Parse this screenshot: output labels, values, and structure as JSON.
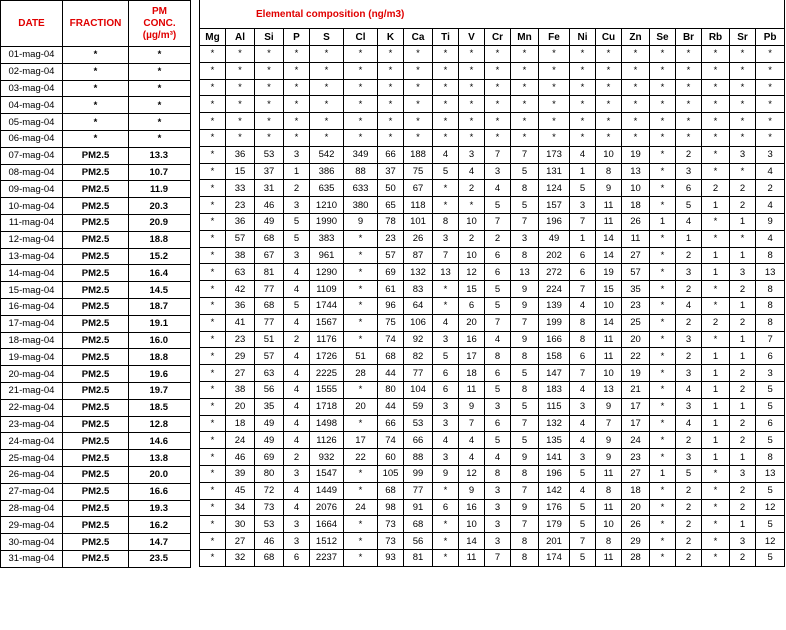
{
  "left_headers": {
    "date": "DATE",
    "fraction": "FRACTION",
    "conc_line1": "PM",
    "conc_line2": "CONC.",
    "conc_line3": "(µg/m³)"
  },
  "right_title": "Elemental composition (ng/m3)",
  "elements": [
    "Mg",
    "Al",
    "Si",
    "P",
    "S",
    "Cl",
    "K",
    "Ca",
    "Ti",
    "V",
    "Cr",
    "Mn",
    "Fe",
    "Ni",
    "Cu",
    "Zn",
    "Se",
    "Br",
    "Rb",
    "Sr",
    "Pb"
  ],
  "rows": [
    {
      "date": "01-mag-04",
      "fraction": "*",
      "conc": "*",
      "values": [
        "*",
        "*",
        "*",
        "*",
        "*",
        "*",
        "*",
        "*",
        "*",
        "*",
        "*",
        "*",
        "*",
        "*",
        "*",
        "*",
        "*",
        "*",
        "*",
        "*",
        "*"
      ]
    },
    {
      "date": "02-mag-04",
      "fraction": "*",
      "conc": "*",
      "values": [
        "*",
        "*",
        "*",
        "*",
        "*",
        "*",
        "*",
        "*",
        "*",
        "*",
        "*",
        "*",
        "*",
        "*",
        "*",
        "*",
        "*",
        "*",
        "*",
        "*",
        "*"
      ]
    },
    {
      "date": "03-mag-04",
      "fraction": "*",
      "conc": "*",
      "values": [
        "*",
        "*",
        "*",
        "*",
        "*",
        "*",
        "*",
        "*",
        "*",
        "*",
        "*",
        "*",
        "*",
        "*",
        "*",
        "*",
        "*",
        "*",
        "*",
        "*",
        "*"
      ]
    },
    {
      "date": "04-mag-04",
      "fraction": "*",
      "conc": "*",
      "values": [
        "*",
        "*",
        "*",
        "*",
        "*",
        "*",
        "*",
        "*",
        "*",
        "*",
        "*",
        "*",
        "*",
        "*",
        "*",
        "*",
        "*",
        "*",
        "*",
        "*",
        "*"
      ]
    },
    {
      "date": "05-mag-04",
      "fraction": "*",
      "conc": "*",
      "values": [
        "*",
        "*",
        "*",
        "*",
        "*",
        "*",
        "*",
        "*",
        "*",
        "*",
        "*",
        "*",
        "*",
        "*",
        "*",
        "*",
        "*",
        "*",
        "*",
        "*",
        "*"
      ]
    },
    {
      "date": "06-mag-04",
      "fraction": "*",
      "conc": "*",
      "values": [
        "*",
        "*",
        "*",
        "*",
        "*",
        "*",
        "*",
        "*",
        "*",
        "*",
        "*",
        "*",
        "*",
        "*",
        "*",
        "*",
        "*",
        "*",
        "*",
        "*",
        "*"
      ]
    },
    {
      "date": "07-mag-04",
      "fraction": "PM2.5",
      "conc": "13.3",
      "values": [
        "*",
        "36",
        "53",
        "3",
        "542",
        "349",
        "66",
        "188",
        "4",
        "3",
        "7",
        "7",
        "173",
        "4",
        "10",
        "19",
        "*",
        "2",
        "*",
        "3",
        "3"
      ]
    },
    {
      "date": "08-mag-04",
      "fraction": "PM2.5",
      "conc": "10.7",
      "values": [
        "*",
        "15",
        "37",
        "1",
        "386",
        "88",
        "37",
        "75",
        "5",
        "4",
        "3",
        "5",
        "131",
        "1",
        "8",
        "13",
        "*",
        "3",
        "*",
        "*",
        "4"
      ]
    },
    {
      "date": "09-mag-04",
      "fraction": "PM2.5",
      "conc": "11.9",
      "values": [
        "*",
        "33",
        "31",
        "2",
        "635",
        "633",
        "50",
        "67",
        "*",
        "2",
        "4",
        "8",
        "124",
        "5",
        "9",
        "10",
        "*",
        "6",
        "2",
        "2",
        "2"
      ]
    },
    {
      "date": "10-mag-04",
      "fraction": "PM2.5",
      "conc": "20.3",
      "values": [
        "*",
        "23",
        "46",
        "3",
        "1210",
        "380",
        "65",
        "118",
        "*",
        "*",
        "5",
        "5",
        "157",
        "3",
        "11",
        "18",
        "*",
        "5",
        "1",
        "2",
        "4"
      ]
    },
    {
      "date": "11-mag-04",
      "fraction": "PM2.5",
      "conc": "20.9",
      "values": [
        "*",
        "36",
        "49",
        "5",
        "1990",
        "9",
        "78",
        "101",
        "8",
        "10",
        "7",
        "7",
        "196",
        "7",
        "11",
        "26",
        "1",
        "4",
        "*",
        "1",
        "9"
      ]
    },
    {
      "date": "12-mag-04",
      "fraction": "PM2.5",
      "conc": "18.8",
      "values": [
        "*",
        "57",
        "68",
        "5",
        "383",
        "*",
        "23",
        "26",
        "3",
        "2",
        "2",
        "3",
        "49",
        "1",
        "14",
        "11",
        "*",
        "1",
        "*",
        "*",
        "4"
      ]
    },
    {
      "date": "13-mag-04",
      "fraction": "PM2.5",
      "conc": "15.2",
      "values": [
        "*",
        "38",
        "67",
        "3",
        "961",
        "*",
        "57",
        "87",
        "7",
        "10",
        "6",
        "8",
        "202",
        "6",
        "14",
        "27",
        "*",
        "2",
        "1",
        "1",
        "8"
      ]
    },
    {
      "date": "14-mag-04",
      "fraction": "PM2.5",
      "conc": "16.4",
      "values": [
        "*",
        "63",
        "81",
        "4",
        "1290",
        "*",
        "69",
        "132",
        "13",
        "12",
        "6",
        "13",
        "272",
        "6",
        "19",
        "57",
        "*",
        "3",
        "1",
        "3",
        "13"
      ]
    },
    {
      "date": "15-mag-04",
      "fraction": "PM2.5",
      "conc": "14.5",
      "values": [
        "*",
        "42",
        "77",
        "4",
        "1109",
        "*",
        "61",
        "83",
        "*",
        "15",
        "5",
        "9",
        "224",
        "7",
        "15",
        "35",
        "*",
        "2",
        "*",
        "2",
        "8"
      ]
    },
    {
      "date": "16-mag-04",
      "fraction": "PM2.5",
      "conc": "18.7",
      "values": [
        "*",
        "36",
        "68",
        "5",
        "1744",
        "*",
        "96",
        "64",
        "*",
        "6",
        "5",
        "9",
        "139",
        "4",
        "10",
        "23",
        "*",
        "4",
        "*",
        "1",
        "8"
      ]
    },
    {
      "date": "17-mag-04",
      "fraction": "PM2.5",
      "conc": "19.1",
      "values": [
        "*",
        "41",
        "77",
        "4",
        "1567",
        "*",
        "75",
        "106",
        "4",
        "20",
        "7",
        "7",
        "199",
        "8",
        "14",
        "25",
        "*",
        "2",
        "2",
        "2",
        "8"
      ]
    },
    {
      "date": "18-mag-04",
      "fraction": "PM2.5",
      "conc": "16.0",
      "values": [
        "*",
        "23",
        "51",
        "2",
        "1176",
        "*",
        "74",
        "92",
        "3",
        "16",
        "4",
        "9",
        "166",
        "8",
        "11",
        "20",
        "*",
        "3",
        "*",
        "1",
        "7"
      ]
    },
    {
      "date": "19-mag-04",
      "fraction": "PM2.5",
      "conc": "18.8",
      "values": [
        "*",
        "29",
        "57",
        "4",
        "1726",
        "51",
        "68",
        "82",
        "5",
        "17",
        "8",
        "8",
        "158",
        "6",
        "11",
        "22",
        "*",
        "2",
        "1",
        "1",
        "6"
      ]
    },
    {
      "date": "20-mag-04",
      "fraction": "PM2.5",
      "conc": "19.6",
      "values": [
        "*",
        "27",
        "63",
        "4",
        "2225",
        "28",
        "44",
        "77",
        "6",
        "18",
        "6",
        "5",
        "147",
        "7",
        "10",
        "19",
        "*",
        "3",
        "1",
        "2",
        "3"
      ]
    },
    {
      "date": "21-mag-04",
      "fraction": "PM2.5",
      "conc": "19.7",
      "values": [
        "*",
        "38",
        "56",
        "4",
        "1555",
        "*",
        "80",
        "104",
        "6",
        "11",
        "5",
        "8",
        "183",
        "4",
        "13",
        "21",
        "*",
        "4",
        "1",
        "2",
        "5"
      ]
    },
    {
      "date": "22-mag-04",
      "fraction": "PM2.5",
      "conc": "18.5",
      "values": [
        "*",
        "20",
        "35",
        "4",
        "1718",
        "20",
        "44",
        "59",
        "3",
        "9",
        "3",
        "5",
        "115",
        "3",
        "9",
        "17",
        "*",
        "3",
        "1",
        "1",
        "5"
      ]
    },
    {
      "date": "23-mag-04",
      "fraction": "PM2.5",
      "conc": "12.8",
      "values": [
        "*",
        "18",
        "49",
        "4",
        "1498",
        "*",
        "66",
        "53",
        "3",
        "7",
        "6",
        "7",
        "132",
        "4",
        "7",
        "17",
        "*",
        "4",
        "1",
        "2",
        "6"
      ]
    },
    {
      "date": "24-mag-04",
      "fraction": "PM2.5",
      "conc": "14.6",
      "values": [
        "*",
        "24",
        "49",
        "4",
        "1126",
        "17",
        "74",
        "66",
        "4",
        "4",
        "5",
        "5",
        "135",
        "4",
        "9",
        "24",
        "*",
        "2",
        "1",
        "2",
        "5"
      ]
    },
    {
      "date": "25-mag-04",
      "fraction": "PM2.5",
      "conc": "13.8",
      "values": [
        "*",
        "46",
        "69",
        "2",
        "932",
        "22",
        "60",
        "88",
        "3",
        "4",
        "4",
        "9",
        "141",
        "3",
        "9",
        "23",
        "*",
        "3",
        "1",
        "1",
        "8"
      ]
    },
    {
      "date": "26-mag-04",
      "fraction": "PM2.5",
      "conc": "20.0",
      "values": [
        "*",
        "39",
        "80",
        "3",
        "1547",
        "*",
        "105",
        "99",
        "9",
        "12",
        "8",
        "8",
        "196",
        "5",
        "11",
        "27",
        "1",
        "5",
        "*",
        "3",
        "13"
      ]
    },
    {
      "date": "27-mag-04",
      "fraction": "PM2.5",
      "conc": "16.6",
      "values": [
        "*",
        "45",
        "72",
        "4",
        "1449",
        "*",
        "68",
        "77",
        "*",
        "9",
        "3",
        "7",
        "142",
        "4",
        "8",
        "18",
        "*",
        "2",
        "*",
        "2",
        "5"
      ]
    },
    {
      "date": "28-mag-04",
      "fraction": "PM2.5",
      "conc": "19.3",
      "values": [
        "*",
        "34",
        "73",
        "4",
        "2076",
        "24",
        "98",
        "91",
        "6",
        "16",
        "3",
        "9",
        "176",
        "5",
        "11",
        "20",
        "*",
        "2",
        "*",
        "2",
        "12"
      ]
    },
    {
      "date": "29-mag-04",
      "fraction": "PM2.5",
      "conc": "16.2",
      "values": [
        "*",
        "30",
        "53",
        "3",
        "1664",
        "*",
        "73",
        "68",
        "*",
        "10",
        "3",
        "7",
        "179",
        "5",
        "10",
        "26",
        "*",
        "2",
        "*",
        "1",
        "5"
      ]
    },
    {
      "date": "30-mag-04",
      "fraction": "PM2.5",
      "conc": "14.7",
      "values": [
        "*",
        "27",
        "46",
        "3",
        "1512",
        "*",
        "73",
        "56",
        "*",
        "14",
        "3",
        "8",
        "201",
        "7",
        "8",
        "29",
        "*",
        "2",
        "*",
        "3",
        "12"
      ]
    },
    {
      "date": "31-mag-04",
      "fraction": "PM2.5",
      "conc": "23.5",
      "values": [
        "*",
        "32",
        "68",
        "6",
        "2237",
        "*",
        "93",
        "81",
        "*",
        "11",
        "7",
        "8",
        "174",
        "5",
        "11",
        "28",
        "*",
        "2",
        "*",
        "2",
        "5"
      ]
    }
  ]
}
